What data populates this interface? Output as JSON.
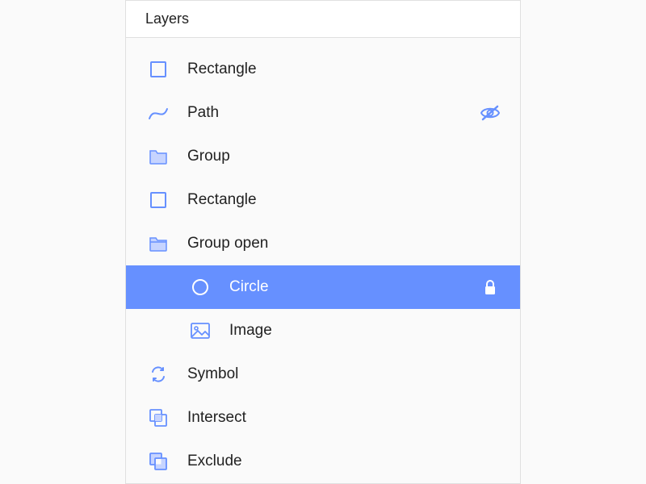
{
  "panel": {
    "title": "Layers"
  },
  "layers": [
    {
      "label": "Rectangle",
      "icon": "rectangle",
      "nested": false,
      "selected": false
    },
    {
      "label": "Path",
      "icon": "path",
      "nested": false,
      "selected": false,
      "rightIcon": "hidden"
    },
    {
      "label": "Group",
      "icon": "folder-closed",
      "nested": false,
      "selected": false
    },
    {
      "label": "Rectangle",
      "icon": "rectangle",
      "nested": false,
      "selected": false
    },
    {
      "label": "Group open",
      "icon": "folder-open",
      "nested": false,
      "selected": false
    },
    {
      "label": "Circle",
      "icon": "circle",
      "nested": true,
      "selected": true,
      "rightIcon": "lock"
    },
    {
      "label": "Image",
      "icon": "image",
      "nested": true,
      "selected": false
    },
    {
      "label": "Symbol",
      "icon": "sync",
      "nested": false,
      "selected": false
    },
    {
      "label": "Intersect",
      "icon": "intersect",
      "nested": false,
      "selected": false
    },
    {
      "label": "Exclude",
      "icon": "exclude",
      "nested": false,
      "selected": false
    }
  ],
  "colors": {
    "accent": "#6690ff",
    "iconStroke": "#6690ff",
    "iconFill": "#c6d4ff"
  }
}
